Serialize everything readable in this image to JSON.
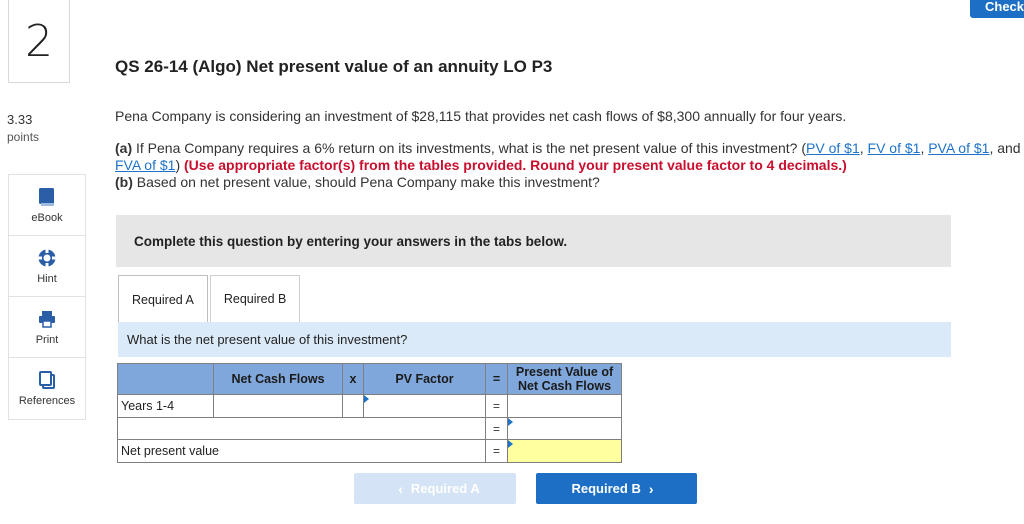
{
  "question_number": "2",
  "points": {
    "value": "3.33",
    "label": "points"
  },
  "check_button": "Check",
  "sidebar": {
    "items": [
      {
        "label": "eBook",
        "icon": "book-icon"
      },
      {
        "label": "Hint",
        "icon": "lifebuoy-icon"
      },
      {
        "label": "Print",
        "icon": "printer-icon"
      },
      {
        "label": "References",
        "icon": "copy-icon"
      }
    ]
  },
  "title": "QS 26-14 (Algo) Net present value of an annuity LO P3",
  "problem": {
    "intro": "Pena Company is considering an investment of $28,115 that provides net cash flows of $8,300 annually for four years.",
    "part_a_label": "(a)",
    "part_a_text": " If Pena Company requires a 6% return on its investments, what is the net present value of this investment? (",
    "links": [
      "PV of $1",
      "FV of $1",
      "PVA of $1",
      "FVA of $1"
    ],
    "sep1": ", ",
    "sep2": ", ",
    "sep3": ", and ",
    "close_paren": ")",
    "instructions_red": " (Use appropriate factor(s) from the tables provided. Round your present value factor to 4 decimals.)",
    "part_b_label": "(b)",
    "part_b_text": " Based on net present value, should Pena Company make this investment?"
  },
  "instruction_banner": "Complete this question by entering your answers in the tabs below.",
  "tabs": [
    {
      "label": "Required A",
      "active": true
    },
    {
      "label": "Required B",
      "active": false
    }
  ],
  "subquestion": "What is the net present value of this investment?",
  "table": {
    "headers": {
      "cash_flows": "Net Cash Flows",
      "times": "x",
      "factor": "PV Factor",
      "equals": "=",
      "present_value": "Present Value of Net Cash Flows"
    },
    "rows": [
      {
        "label": "Years 1-4",
        "equals": "="
      },
      {
        "label": "",
        "equals": "="
      },
      {
        "label": "Net present value",
        "equals": "="
      }
    ]
  },
  "nav": {
    "prev_label": "Required A",
    "next_label": "Required B"
  },
  "colors": {
    "accent": "#1c6fc4",
    "header_blue": "#7fa7db",
    "red_instruction": "#c8102e",
    "answer_yellow": "#ffff9f"
  }
}
